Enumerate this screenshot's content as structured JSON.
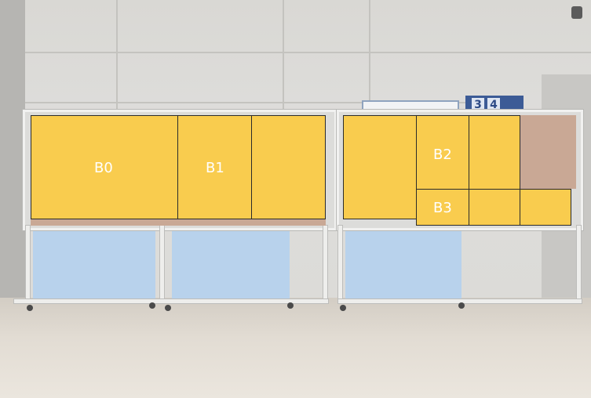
{
  "sign": {
    "numbers": [
      "3",
      "4"
    ]
  },
  "blocks": [
    {
      "id": "b0",
      "label": "B0"
    },
    {
      "id": "b1",
      "label": "B1"
    },
    {
      "id": "b2",
      "label": "B2"
    },
    {
      "id": "b3",
      "label": "B3"
    }
  ],
  "colors": {
    "block_fill": "#f9cc4e",
    "block_border": "#2b2b2b",
    "label": "#ffffff",
    "tan_area": "#c9a895",
    "lower_panel": "#b8d2ec"
  }
}
